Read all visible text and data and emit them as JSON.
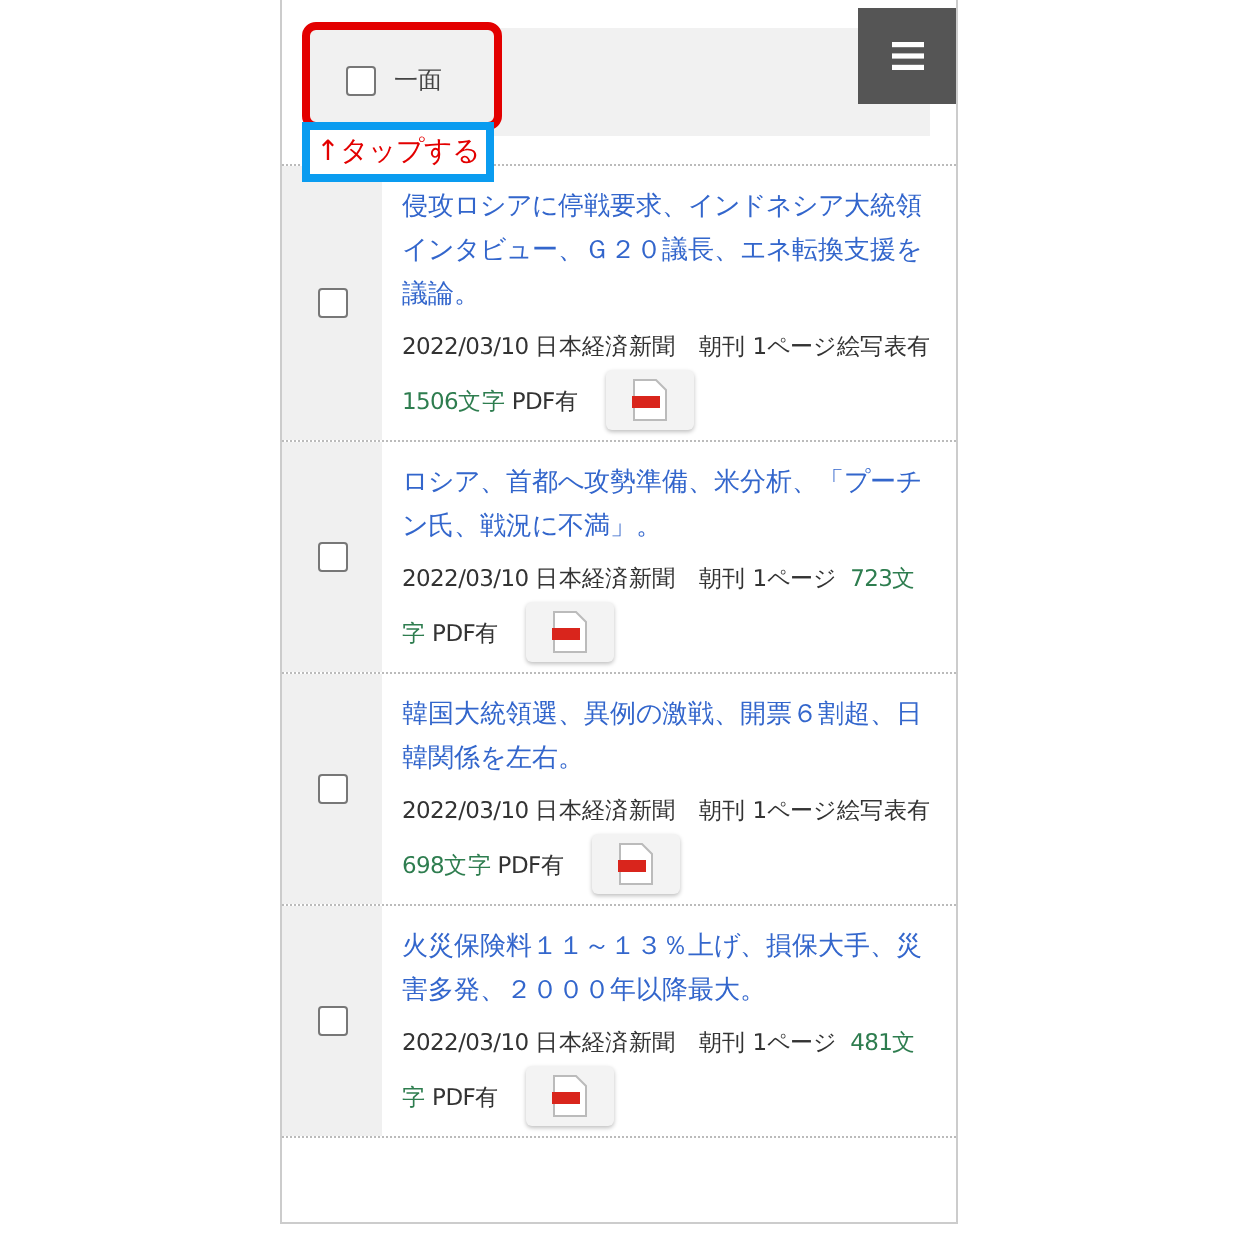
{
  "header": {
    "checkbox": {
      "label": "一面",
      "checked": false
    },
    "callout": "↑タップする"
  },
  "articles": [
    {
      "title": "侵攻ロシアに停戦要求、インドネシア大統領インタビュー、Ｇ２０議長、エネ転換支援を議論。",
      "checked": false,
      "date": "2022/03/10",
      "paper": "日本経済新聞",
      "edition": "朝刊 1ページ",
      "extra": "絵写表有",
      "chars": "1506文字",
      "pdf": "PDF有"
    },
    {
      "title": "ロシア、首都へ攻勢準備、米分析、「プーチン氏、戦況に不満」。",
      "checked": false,
      "date": "2022/03/10",
      "paper": "日本経済新聞",
      "edition": "朝刊 1ページ",
      "chars": "723文字",
      "pdf": "PDF有"
    },
    {
      "title": "韓国大統領選、異例の激戦、開票６割超、日韓関係を左右。",
      "checked": false,
      "date": "2022/03/10",
      "paper": "日本経済新聞",
      "edition": "朝刊 1ページ",
      "extra": "絵写表有",
      "chars": "698文字",
      "pdf": "PDF有"
    },
    {
      "title": "火災保険料１１～１３％上げ、損保大手、災害多発、２０００年以降最大。",
      "checked": false,
      "date": "2022/03/10",
      "paper": "日本経済新聞",
      "edition": "朝刊 1ページ",
      "chars": "481文字",
      "pdf": "PDF有"
    }
  ]
}
